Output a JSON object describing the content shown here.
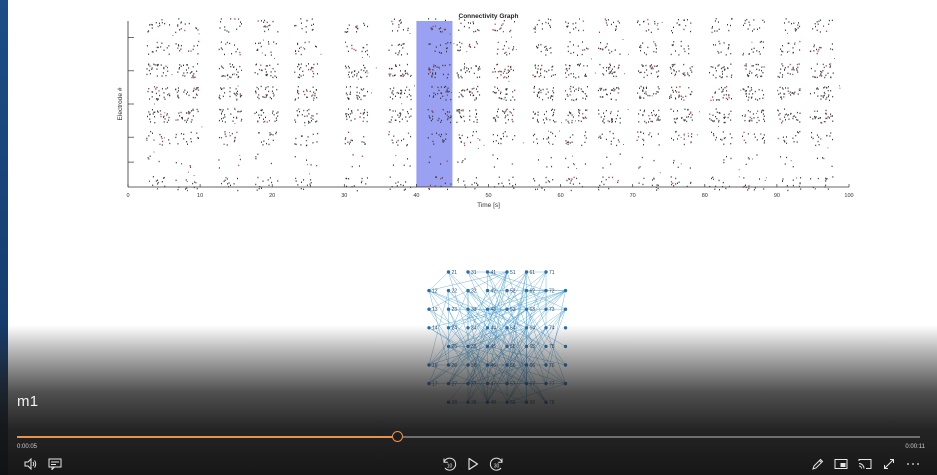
{
  "player": {
    "video_title": "m1",
    "time_current": "0:00:05",
    "time_total": "0:00:11",
    "progress_fraction": 0.422,
    "accent_color": "#e8924f",
    "controls_left": [
      {
        "name": "volume-icon"
      },
      {
        "name": "captions-icon"
      }
    ],
    "controls_center": [
      {
        "name": "rewind-10-icon",
        "label": "10"
      },
      {
        "name": "play-icon"
      },
      {
        "name": "forward-30-icon",
        "label": "30"
      }
    ],
    "controls_right": [
      {
        "name": "pen-icon"
      },
      {
        "name": "mini-view-icon"
      },
      {
        "name": "cast-icon"
      },
      {
        "name": "fullscreen-icon"
      },
      {
        "name": "more-icon"
      }
    ]
  },
  "chart_data": [
    {
      "type": "scatter",
      "title": "Connectivity Graph",
      "xlabel": "Time [s]",
      "ylabel": "Electrode #",
      "xlim": [
        0,
        100
      ],
      "xticks": [
        0,
        10,
        20,
        30,
        40,
        50,
        60,
        70,
        80,
        90,
        100
      ],
      "highlight_window": {
        "x": [
          40,
          45
        ],
        "color": "#9aa0f2"
      },
      "burst_times": [
        3.5,
        7.5,
        13.5,
        18.5,
        24,
        31,
        37,
        42.5,
        46.5,
        51.5,
        57,
        61.5,
        66,
        71.5,
        76,
        81.5,
        86,
        91,
        95.5
      ],
      "electrode_bands": 8,
      "grid": false
    },
    {
      "type": "diagram",
      "nodes": [
        {
          "label": "21",
          "col": 1,
          "row": 0
        },
        {
          "label": "31",
          "col": 2,
          "row": 0
        },
        {
          "label": "41",
          "col": 3,
          "row": 0
        },
        {
          "label": "51",
          "col": 4,
          "row": 0
        },
        {
          "label": "61",
          "col": 5,
          "row": 0
        },
        {
          "label": "71",
          "col": 6,
          "row": 0
        },
        {
          "label": "12",
          "col": 0,
          "row": 1
        },
        {
          "label": "22",
          "col": 1,
          "row": 1
        },
        {
          "label": "32",
          "col": 2,
          "row": 1
        },
        {
          "label": "42",
          "col": 3,
          "row": 1
        },
        {
          "label": "52",
          "col": 4,
          "row": 1
        },
        {
          "label": "62",
          "col": 5,
          "row": 1
        },
        {
          "label": "72",
          "col": 6,
          "row": 1
        },
        {
          "label": "",
          "col": 7,
          "row": 1
        },
        {
          "label": "13",
          "col": 0,
          "row": 2
        },
        {
          "label": "23",
          "col": 1,
          "row": 2
        },
        {
          "label": "33",
          "col": 2,
          "row": 2
        },
        {
          "label": "43",
          "col": 3,
          "row": 2
        },
        {
          "label": "53",
          "col": 4,
          "row": 2
        },
        {
          "label": "63",
          "col": 5,
          "row": 2
        },
        {
          "label": "73",
          "col": 6,
          "row": 2
        },
        {
          "label": "",
          "col": 7,
          "row": 2
        },
        {
          "label": "14",
          "col": 0,
          "row": 3
        },
        {
          "label": "24",
          "col": 1,
          "row": 3
        },
        {
          "label": "34",
          "col": 2,
          "row": 3
        },
        {
          "label": "44",
          "col": 3,
          "row": 3
        },
        {
          "label": "54",
          "col": 4,
          "row": 3
        },
        {
          "label": "64",
          "col": 5,
          "row": 3
        },
        {
          "label": "74",
          "col": 6,
          "row": 3
        },
        {
          "label": "",
          "col": 7,
          "row": 3
        },
        {
          "label": "25",
          "col": 1,
          "row": 4
        },
        {
          "label": "35",
          "col": 2,
          "row": 4
        },
        {
          "label": "45",
          "col": 3,
          "row": 4
        },
        {
          "label": "55",
          "col": 4,
          "row": 4
        },
        {
          "label": "65",
          "col": 5,
          "row": 4
        },
        {
          "label": "75",
          "col": 6,
          "row": 4
        },
        {
          "label": "",
          "col": 7,
          "row": 4
        },
        {
          "label": "16",
          "col": 0,
          "row": 5
        },
        {
          "label": "26",
          "col": 1,
          "row": 5
        },
        {
          "label": "36",
          "col": 2,
          "row": 5
        },
        {
          "label": "46",
          "col": 3,
          "row": 5
        },
        {
          "label": "56",
          "col": 4,
          "row": 5
        },
        {
          "label": "66",
          "col": 5,
          "row": 5
        },
        {
          "label": "76",
          "col": 6,
          "row": 5
        },
        {
          "label": "",
          "col": 7,
          "row": 5
        },
        {
          "label": "17",
          "col": 0,
          "row": 6
        },
        {
          "label": "27",
          "col": 1,
          "row": 6
        },
        {
          "label": "37",
          "col": 2,
          "row": 6
        },
        {
          "label": "47",
          "col": 3,
          "row": 6
        },
        {
          "label": "57",
          "col": 4,
          "row": 6
        },
        {
          "label": "67",
          "col": 5,
          "row": 6
        },
        {
          "label": "77",
          "col": 6,
          "row": 6
        },
        {
          "label": "",
          "col": 7,
          "row": 6
        },
        {
          "label": "28",
          "col": 1,
          "row": 7
        },
        {
          "label": "38",
          "col": 2,
          "row": 7
        },
        {
          "label": "48",
          "col": 3,
          "row": 7
        },
        {
          "label": "58",
          "col": 4,
          "row": 7
        },
        {
          "label": "68",
          "col": 5,
          "row": 7
        },
        {
          "label": "78",
          "col": 6,
          "row": 7
        }
      ],
      "node_color": "#2a6fb0",
      "edge_color": "#4a9fd0"
    }
  ]
}
